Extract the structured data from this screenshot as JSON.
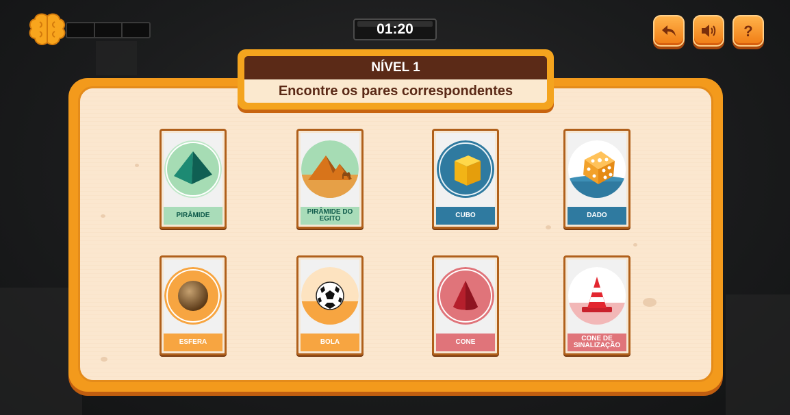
{
  "hud": {
    "timer": "01:20",
    "progress_fraction": 0,
    "progress_segments": 3,
    "icons": [
      "brain-icon",
      "back-icon",
      "sound-icon",
      "help-icon"
    ]
  },
  "title": {
    "level": "NÍVEL 1",
    "instruction": "Encontre os pares correspondentes"
  },
  "colors": {
    "accent": "#f39a1c",
    "banner_dark": "#5b2a17",
    "board_bg": "#fbe7cf"
  },
  "cards": [
    {
      "label": "PIRÂMIDE",
      "icon": "pyramid-icon",
      "label_bg": "#a9dcb9",
      "label_color": "#0e5a4a"
    },
    {
      "label": "PIRÂMIDE DO EGITO",
      "icon": "egypt-pyramid-icon",
      "label_bg": "#a9dcb9",
      "label_color": "#0e5a4a"
    },
    {
      "label": "CUBO",
      "icon": "cube-icon",
      "label_bg": "#2f7aa0",
      "label_color": "#ffffff"
    },
    {
      "label": "DADO",
      "icon": "dice-icon",
      "label_bg": "#2f7aa0",
      "label_color": "#ffffff"
    },
    {
      "label": "ESFERA",
      "icon": "sphere-icon",
      "label_bg": "#f7a541",
      "label_color": "#ffffff"
    },
    {
      "label": "BOLA",
      "icon": "soccer-ball-icon",
      "label_bg": "#f7a541",
      "label_color": "#ffffff"
    },
    {
      "label": "CONE",
      "icon": "cone-icon",
      "label_bg": "#e0747a",
      "label_color": "#ffffff"
    },
    {
      "label": "CONE DE SINALIZAÇÃO",
      "icon": "traffic-cone-icon",
      "label_bg": "#e0747a",
      "label_color": "#ffffff"
    }
  ]
}
